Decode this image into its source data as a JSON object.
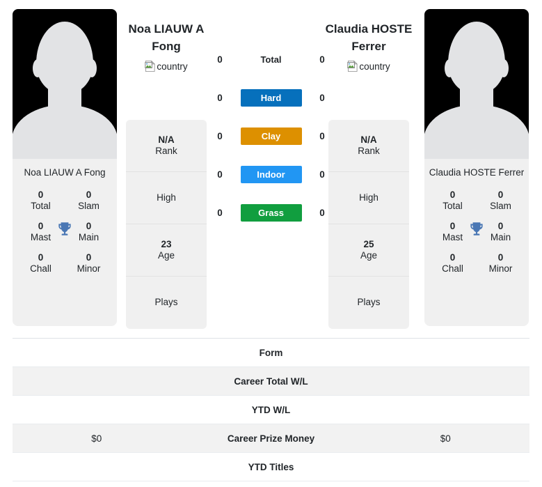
{
  "players": {
    "left": {
      "name": "Noa LIAUW A Fong",
      "name_display": "Noa LIAUW A\nFong",
      "photo_caption": "Noa LIAUW A Fong",
      "flag_alt": "country",
      "rank": "N/A",
      "rank_label": "Rank",
      "high_label": "High",
      "high_value": "",
      "age": "23",
      "age_label": "Age",
      "plays_label": "Plays",
      "plays_value": "",
      "titles": [
        {
          "value": "0",
          "label": "Total"
        },
        {
          "value": "0",
          "label": "Slam"
        },
        {
          "value": "0",
          "label": "Mast"
        },
        {
          "value": "0",
          "label": "Main"
        },
        {
          "value": "0",
          "label": "Chall"
        },
        {
          "value": "0",
          "label": "Minor"
        }
      ]
    },
    "right": {
      "name": "Claudia HOSTE Ferrer",
      "name_display": "Claudia HOSTE\nFerrer",
      "photo_caption": "Claudia HOSTE Ferrer",
      "flag_alt": "country",
      "rank": "N/A",
      "rank_label": "Rank",
      "high_label": "High",
      "high_value": "",
      "age": "25",
      "age_label": "Age",
      "plays_label": "Plays",
      "plays_value": "",
      "titles": [
        {
          "value": "0",
          "label": "Total"
        },
        {
          "value": "0",
          "label": "Slam"
        },
        {
          "value": "0",
          "label": "Mast"
        },
        {
          "value": "0",
          "label": "Main"
        },
        {
          "value": "0",
          "label": "Chall"
        },
        {
          "value": "0",
          "label": "Minor"
        }
      ]
    }
  },
  "surfaces": [
    {
      "key": "total",
      "label": "Total",
      "left": "0",
      "right": "0",
      "bg": "transparent",
      "fg": "#212529"
    },
    {
      "key": "hard",
      "label": "Hard",
      "left": "0",
      "right": "0",
      "bg": "#0670bc",
      "fg": "#ffffff"
    },
    {
      "key": "clay",
      "label": "Clay",
      "left": "0",
      "right": "0",
      "bg": "#dd9000",
      "fg": "#ffffff"
    },
    {
      "key": "indoor",
      "label": "Indoor",
      "left": "0",
      "right": "0",
      "bg": "#2196f3",
      "fg": "#ffffff"
    },
    {
      "key": "grass",
      "label": "Grass",
      "left": "0",
      "right": "0",
      "bg": "#119e3f",
      "fg": "#ffffff"
    }
  ],
  "stats": [
    {
      "key": "form",
      "label": "Form",
      "left": "",
      "right": ""
    },
    {
      "key": "career_total_wl",
      "label": "Career Total W/L",
      "left": "",
      "right": ""
    },
    {
      "key": "ytd_wl",
      "label": "YTD W/L",
      "left": "",
      "right": ""
    },
    {
      "key": "career_prize",
      "label": "Career Prize Money",
      "left": "$0",
      "right": "$0"
    },
    {
      "key": "ytd_titles",
      "label": "YTD Titles",
      "left": "",
      "right": ""
    }
  ]
}
